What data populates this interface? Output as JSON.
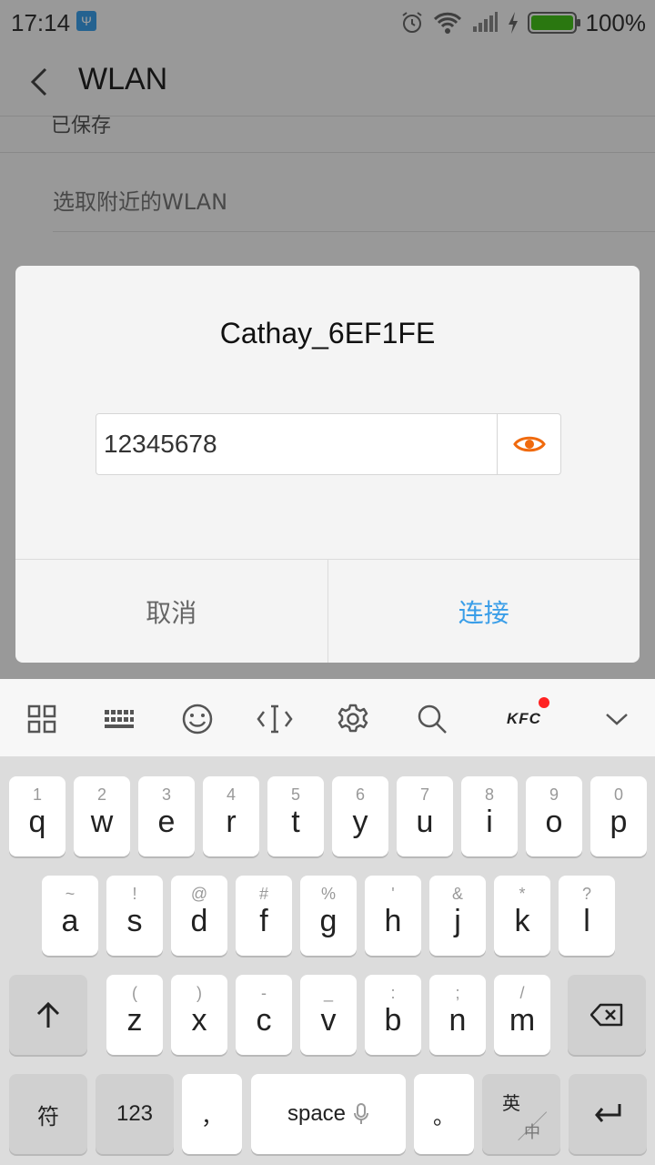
{
  "status_bar": {
    "time": "17:14",
    "battery_pct": "100%",
    "battery_level": 1.0,
    "icons": [
      "usb-debug-icon",
      "alarm-icon",
      "wifi-icon",
      "signal-icon",
      "charging-icon",
      "battery-icon"
    ]
  },
  "titlebar": {
    "title": "WLAN",
    "back_icon": "chevron-left-icon"
  },
  "page": {
    "saved_label": "已保存",
    "nearby_label": "选取附近的WLAN"
  },
  "dialog": {
    "network_name": "Cathay_6EF1FE",
    "password_value": "12345678",
    "eye_icon": "show-password-icon",
    "eye_color": "#f06a0e",
    "cancel_label": "取消",
    "connect_label": "连接",
    "accent": "#3a9ee8"
  },
  "toolbar": {
    "icons": [
      "grid-icon",
      "keyboard-icon",
      "emoji-icon",
      "cursor-icon",
      "settings-icon",
      "search-icon",
      "kfc-icon",
      "chevron-down-icon"
    ],
    "kfc_label": "KFC"
  },
  "keyboard": {
    "row1": [
      {
        "sub": "1",
        "main": "q"
      },
      {
        "sub": "2",
        "main": "w"
      },
      {
        "sub": "3",
        "main": "e"
      },
      {
        "sub": "4",
        "main": "r"
      },
      {
        "sub": "5",
        "main": "t"
      },
      {
        "sub": "6",
        "main": "y"
      },
      {
        "sub": "7",
        "main": "u"
      },
      {
        "sub": "8",
        "main": "i"
      },
      {
        "sub": "9",
        "main": "o"
      },
      {
        "sub": "0",
        "main": "p"
      }
    ],
    "row2": [
      {
        "sub": "~",
        "main": "a"
      },
      {
        "sub": "!",
        "main": "s"
      },
      {
        "sub": "@",
        "main": "d"
      },
      {
        "sub": "#",
        "main": "f"
      },
      {
        "sub": "%",
        "main": "g"
      },
      {
        "sub": "'",
        "main": "h"
      },
      {
        "sub": "&",
        "main": "j"
      },
      {
        "sub": "*",
        "main": "k"
      },
      {
        "sub": "?",
        "main": "l"
      }
    ],
    "row3": [
      {
        "sub": "(",
        "main": "z"
      },
      {
        "sub": ")",
        "main": "x"
      },
      {
        "sub": "-",
        "main": "c"
      },
      {
        "sub": "_",
        "main": "v"
      },
      {
        "sub": ":",
        "main": "b"
      },
      {
        "sub": ";",
        "main": "n"
      },
      {
        "sub": "/",
        "main": "m"
      }
    ],
    "symbol_label": "符",
    "num_label": "123",
    "comma_label": "，",
    "space_label": "space",
    "period_label": "。",
    "lang_primary": "英",
    "lang_secondary": "中"
  }
}
